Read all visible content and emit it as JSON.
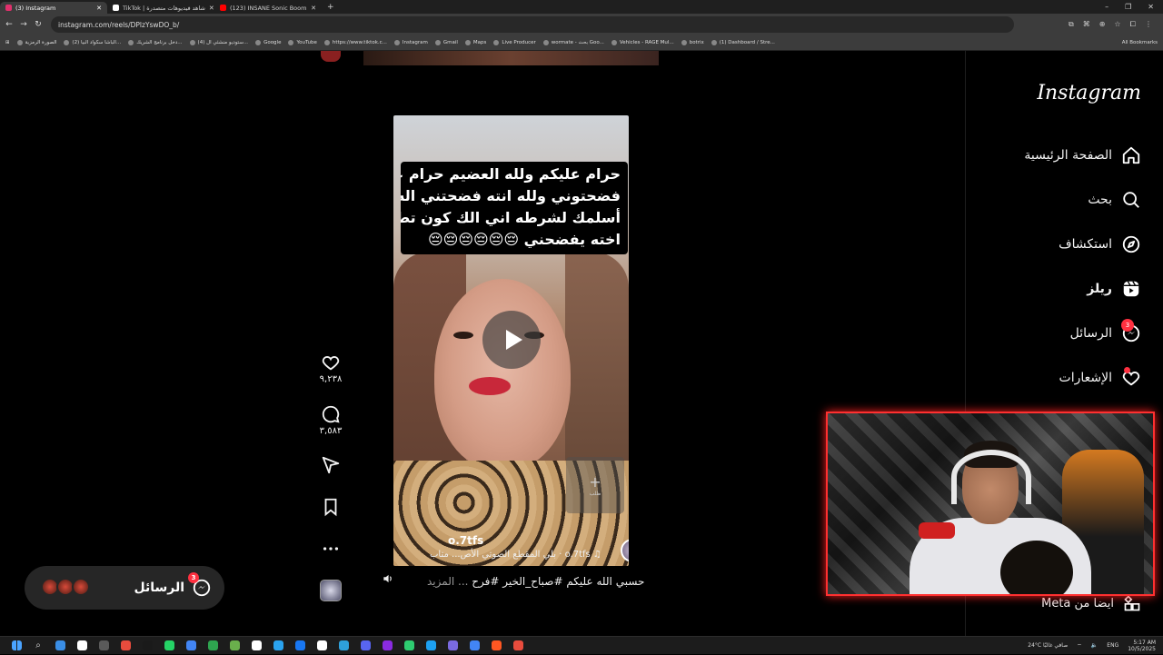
{
  "browser": {
    "tabs": [
      {
        "title": "(3) Instagram",
        "color": "#e1306c",
        "active": true
      },
      {
        "title": "TikTok | شاهد فيديوهات متصدرة",
        "color": "#ffffff",
        "active": false
      },
      {
        "title": "(123) INSANE Sonic Boom",
        "color": "#ff0000",
        "active": false
      }
    ],
    "new_tab": "+",
    "url": "instagram.com/reels/DPlzYswDO_b/",
    "bookmarks": [
      "الصورة الرمزية",
      "(2) الباشا سكواد البيا...",
      "دخل برنامج الشريك...",
      "(4) ستوديو منشئي ال...",
      "Google",
      "YouTube",
      "https://www.tiktok.c...",
      "Instagram",
      "Gmail",
      "Maps",
      "Live Producer",
      "wormate - بحث Goo...",
      "Vehicles - RAGE Mul...",
      "botrix",
      "(1) Dashboard / Stre..."
    ],
    "all_bookmarks": "All Bookmarks"
  },
  "sidebar": {
    "logo": "Instagram",
    "items": [
      {
        "label": "الصفحة الرئيسية",
        "icon": "home-icon"
      },
      {
        "label": "بحث",
        "icon": "search-icon"
      },
      {
        "label": "استكشاف",
        "icon": "explore-icon"
      },
      {
        "label": "ريلز",
        "icon": "reels-icon"
      },
      {
        "label": "الرسائل",
        "icon": "messenger-icon",
        "badge": "3"
      },
      {
        "label": "الإشعارات",
        "icon": "heart-icon"
      }
    ],
    "meta": "ايضا من Meta"
  },
  "reel": {
    "overlay_lines": [
      "حرام عليكم ولله العضيم حرام عليكم",
      "فضحتوني ولله انته فضحتني اله",
      "أسلمك لشرطه اني الك كون تطلع ب",
      "اخته يفضحني 😔😔😔😔😔😔"
    ],
    "follow_tile": "+",
    "follow_tile_sub": "طلب",
    "username": "o.7tfs",
    "audio_text": "♫ o.7tfs · بلي  المقطع الصوتي الأص... متاب",
    "caption": "حسبي الله عليكم #صباح_الخير #فرح",
    "caption_more": "... المزيد",
    "likes": "٩,٢٣٨",
    "comments": "٣,٥٨٣"
  },
  "messages_pill": {
    "label": "الرسائل",
    "badge": "3"
  },
  "taskbar": {
    "icons": [
      "#3a8ee6",
      "#ffffff",
      "#5a5a5a",
      "#e84c3d",
      "#1a1a1a",
      "#25d366",
      "#4285f4",
      "#2ea44f",
      "#6ab04c",
      "#ffffff",
      "#2aa3ef",
      "#1877f2",
      "#ffffff",
      "#2ea0da",
      "#5865f2",
      "#8a2be2",
      "#2ecc71",
      "#1da1f2",
      "#7a6ae0",
      "#4285f4",
      "#ff5722",
      "#e84c3d"
    ],
    "weather": "24°C  صافي غالبًا",
    "lang": "ENG",
    "time": "5:17 AM",
    "date": "10/5/2025"
  }
}
